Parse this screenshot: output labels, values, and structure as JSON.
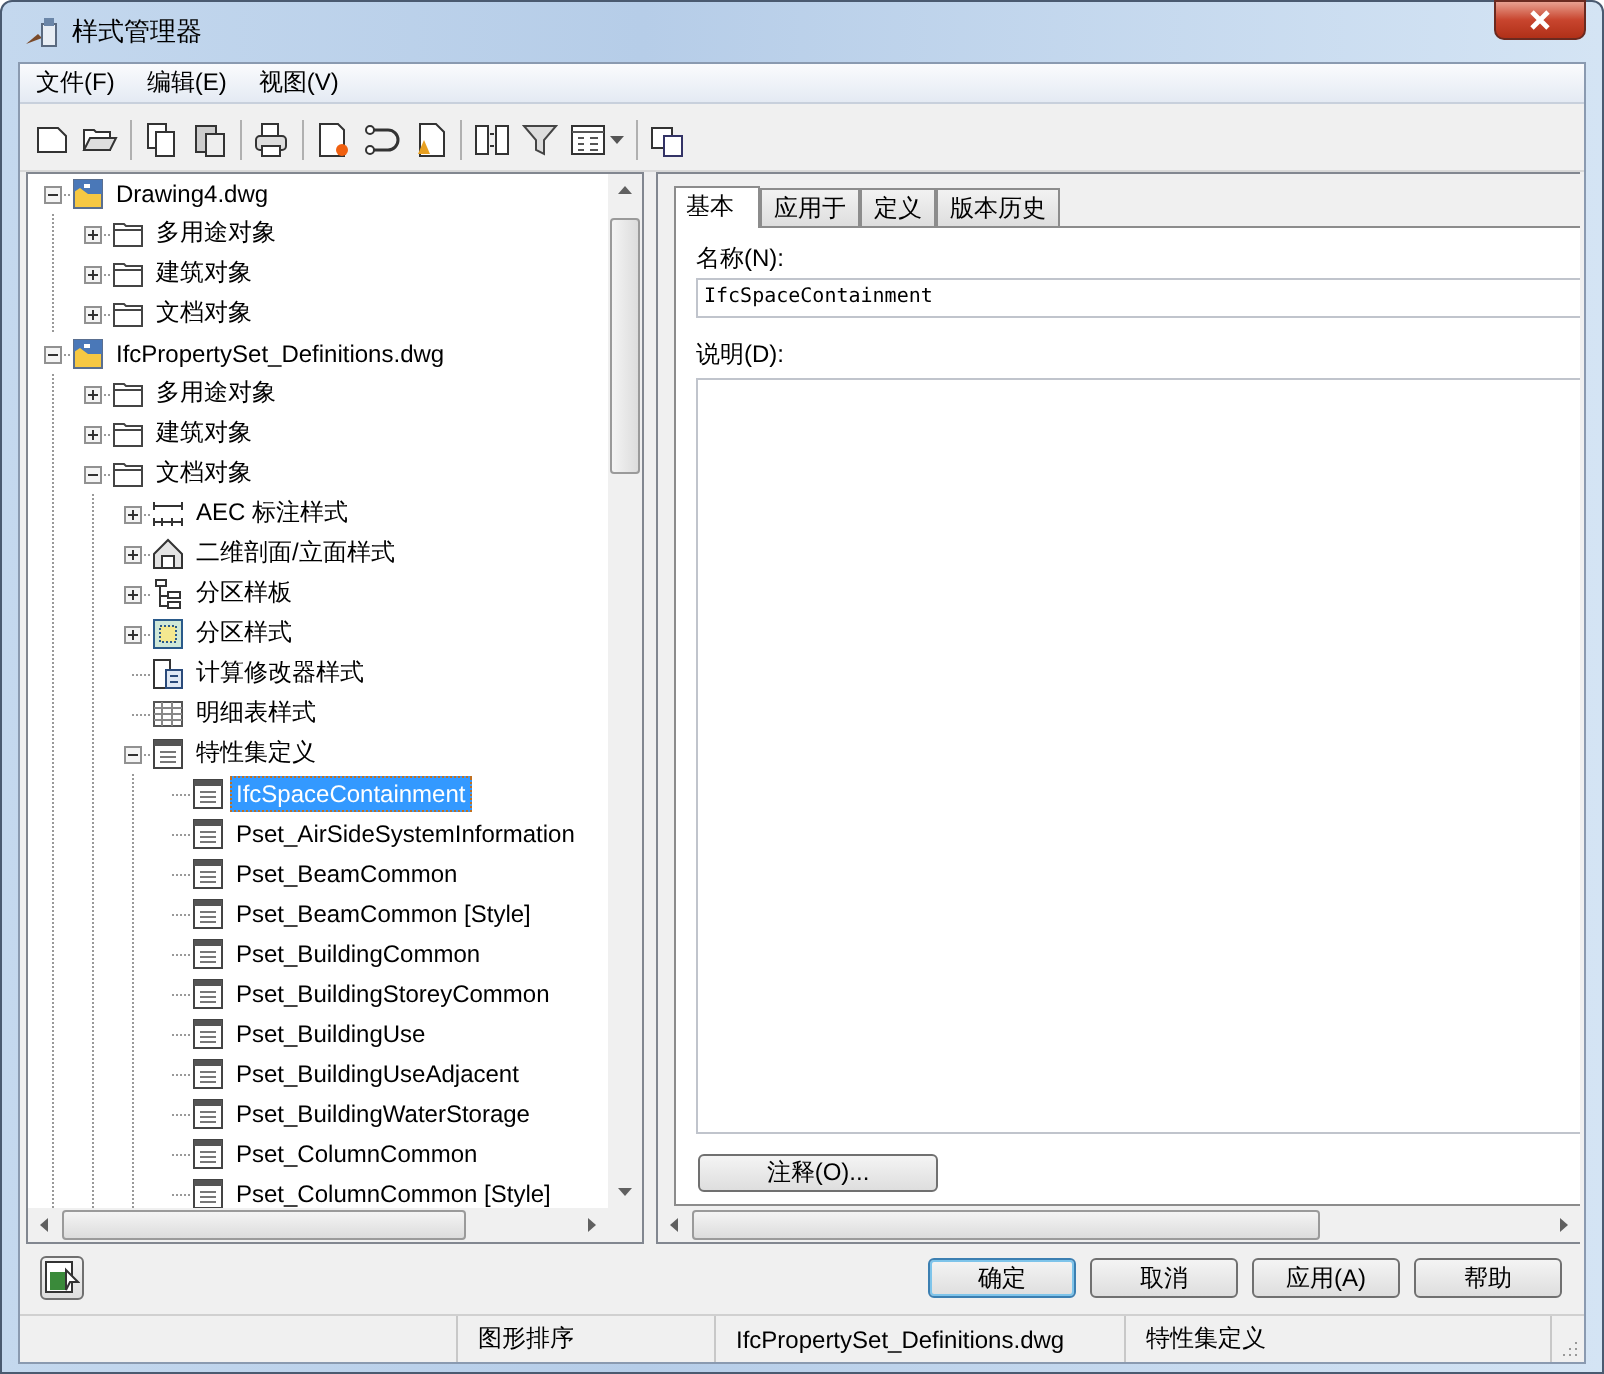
{
  "window": {
    "title": "样式管理器"
  },
  "menu": [
    "文件(F)",
    "编辑(E)",
    "视图(V)"
  ],
  "tree": [
    {
      "label": "Drawing4.dwg",
      "kind": "drawing",
      "expanded": true,
      "selected": false,
      "children": [
        {
          "label": "多用途对象",
          "kind": "folder",
          "expanded": false,
          "selected": false
        },
        {
          "label": "建筑对象",
          "kind": "folder",
          "expanded": false,
          "selected": false
        },
        {
          "label": "文档对象",
          "kind": "folder",
          "expanded": false,
          "selected": false
        }
      ]
    },
    {
      "label": "IfcPropertySet_Definitions.dwg",
      "kind": "drawing",
      "expanded": true,
      "selected": false,
      "children": [
        {
          "label": "多用途对象",
          "kind": "folder",
          "expanded": false,
          "selected": false
        },
        {
          "label": "建筑对象",
          "kind": "folder",
          "expanded": false,
          "selected": false
        },
        {
          "label": "文档对象",
          "kind": "folder",
          "expanded": true,
          "selected": false,
          "children": [
            {
              "label": "AEC 标注样式",
              "kind": "dimension",
              "expanded": false,
              "selected": false
            },
            {
              "label": "二维剖面/立面样式",
              "kind": "elevation",
              "expanded": false,
              "selected": false
            },
            {
              "label": "分区样板",
              "kind": "template",
              "expanded": false,
              "selected": false
            },
            {
              "label": "分区样式",
              "kind": "zone",
              "expanded": false,
              "selected": false
            },
            {
              "label": "计算修改器样式",
              "kind": "calc",
              "selected": false
            },
            {
              "label": "明细表样式",
              "kind": "schedule",
              "selected": false
            },
            {
              "label": "特性集定义",
              "kind": "pset",
              "expanded": true,
              "selected": false,
              "children": [
                {
                  "label": "IfcSpaceContainment",
                  "kind": "pset",
                  "selected": true
                },
                {
                  "label": "Pset_AirSideSystemInformation",
                  "kind": "pset",
                  "selected": false
                },
                {
                  "label": "Pset_BeamCommon",
                  "kind": "pset",
                  "selected": false
                },
                {
                  "label": "Pset_BeamCommon [Style]",
                  "kind": "pset",
                  "selected": false
                },
                {
                  "label": "Pset_BuildingCommon",
                  "kind": "pset",
                  "selected": false
                },
                {
                  "label": "Pset_BuildingStoreyCommon",
                  "kind": "pset",
                  "selected": false
                },
                {
                  "label": "Pset_BuildingUse",
                  "kind": "pset",
                  "selected": false
                },
                {
                  "label": "Pset_BuildingUseAdjacent",
                  "kind": "pset",
                  "selected": false
                },
                {
                  "label": "Pset_BuildingWaterStorage",
                  "kind": "pset",
                  "selected": false
                },
                {
                  "label": "Pset_ColumnCommon",
                  "kind": "pset",
                  "selected": false
                },
                {
                  "label": "Pset_ColumnCommon [Style]",
                  "kind": "pset",
                  "selected": false
                }
              ]
            }
          ]
        }
      ]
    }
  ],
  "tabs": [
    {
      "label": "基本",
      "selected": true
    },
    {
      "label": "应用于",
      "selected": false
    },
    {
      "label": "定义",
      "selected": false
    },
    {
      "label": "版本历史",
      "selected": false
    }
  ],
  "form": {
    "name_label": "名称(N):",
    "name_value": "IfcSpaceContainment",
    "description_label": "说明(D):",
    "notes_button": "注释(O)..."
  },
  "buttons": [
    {
      "label": "确定",
      "default": true
    },
    {
      "label": "取消",
      "default": false
    },
    {
      "label": "应用(A)",
      "default": false
    },
    {
      "label": "帮助",
      "default": false
    }
  ],
  "status_bar": [
    "图形排序",
    "IfcPropertySet_Definitions.dwg",
    "特性集定义"
  ]
}
